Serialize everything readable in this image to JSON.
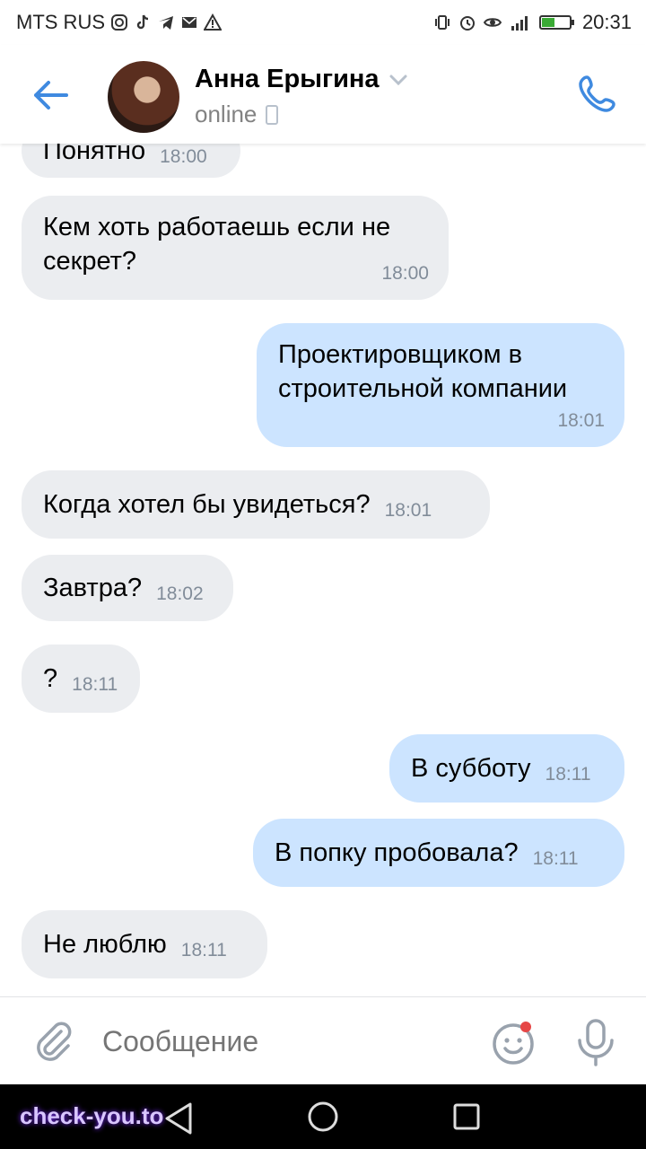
{
  "status_bar": {
    "carrier": "MTS RUS",
    "clock": "20:31",
    "icons": [
      "instagram-icon",
      "tiktok-icon",
      "telegram-icon",
      "mail-icon",
      "warning-icon",
      "vibrate-icon",
      "alarm-icon",
      "eye-icon",
      "signal-icon",
      "battery-icon"
    ]
  },
  "header": {
    "name": "Анна Ерыгина",
    "presence": "online"
  },
  "messages": [
    {
      "dir": "in",
      "text": "Понятно",
      "time": "18:00"
    },
    {
      "dir": "in",
      "text": "Кем хоть работаешь если не секрет?",
      "time": "18:00"
    },
    {
      "dir": "out",
      "text": "Проектировщиком в строительной компании",
      "time": "18:01"
    },
    {
      "dir": "in",
      "text": "Когда хотел бы увидеться?",
      "time": "18:01"
    },
    {
      "dir": "in",
      "text": "Завтра?",
      "time": "18:02"
    },
    {
      "dir": "in",
      "text": "?",
      "time": "18:11"
    },
    {
      "dir": "out",
      "text": "В субботу",
      "time": "18:11"
    },
    {
      "dir": "out",
      "text": "В попку пробовала?",
      "time": "18:11"
    },
    {
      "dir": "in",
      "text": "Не люблю",
      "time": "18:11"
    }
  ],
  "composer": {
    "placeholder": "Сообщение"
  },
  "watermark": "check-you.to",
  "colors": {
    "accent": "#3f8ae0",
    "incoming_bubble": "#ebedf0",
    "outgoing_bubble": "#cce4ff",
    "notification_dot": "#e64646"
  }
}
